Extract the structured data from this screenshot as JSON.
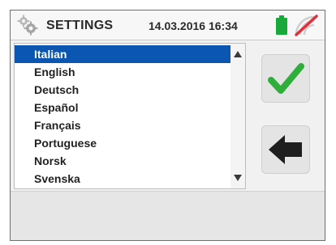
{
  "header": {
    "title": "SETTINGS",
    "datetime": "14.03.2016 16:34",
    "settings_icon": "gear-icon",
    "battery_icon": "battery-icon",
    "signal_icon": "no-signal-icon"
  },
  "languages": {
    "selected": "Italian",
    "items": [
      "Italian",
      "English",
      "Deutsch",
      "Español",
      "Français",
      "Portuguese",
      "Norsk",
      "Svenska"
    ]
  },
  "buttons": {
    "confirm_icon": "checkmark-icon",
    "back_icon": "arrow-left-icon"
  },
  "colors": {
    "selection": "#0a56b0",
    "confirm": "#2fae3b",
    "battery": "#19a83a",
    "no_signal": "#e0313b"
  }
}
